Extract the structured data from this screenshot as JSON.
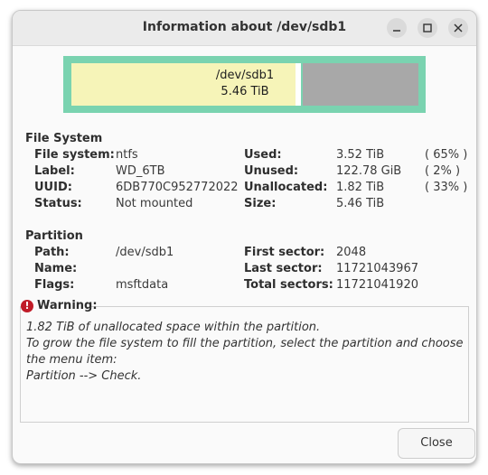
{
  "window": {
    "title": "Information about /dev/sdb1"
  },
  "usage_bar": {
    "label_path": "/dev/sdb1",
    "label_size": "5.46 TiB",
    "used_fraction": 0.65,
    "unused_fraction": 0.02,
    "unallocated_fraction": 0.33,
    "colors": {
      "border": "#7ad3b0",
      "used": "#f6f4b8",
      "unused": "#ffffff",
      "unallocated": "#a8a8a8"
    }
  },
  "file_system": {
    "heading": "File System",
    "fs_label": "File system:",
    "fs_value": "ntfs",
    "label_label": "Label:",
    "label_value": "WD_6TB",
    "uuid_label": "UUID:",
    "uuid_value": "6DB770C952772022",
    "status_label": "Status:",
    "status_value": "Not mounted",
    "used_label": "Used:",
    "used_value": "3.52 TiB",
    "used_pct": "( 65% )",
    "unused_label": "Unused:",
    "unused_value": "122.78 GiB",
    "unused_pct": "( 2% )",
    "unalloc_label": "Unallocated:",
    "unalloc_value": "1.82 TiB",
    "unalloc_pct": "( 33% )",
    "size_label": "Size:",
    "size_value": "5.46 TiB"
  },
  "partition": {
    "heading": "Partition",
    "path_label": "Path:",
    "path_value": "/dev/sdb1",
    "name_label": "Name:",
    "name_value": "",
    "flags_label": "Flags:",
    "flags_value": "msftdata",
    "first_label": "First sector:",
    "first_value": "2048",
    "last_label": "Last sector:",
    "last_value": "11721043967",
    "total_label": "Total sectors:",
    "total_value": "11721041920"
  },
  "warning": {
    "title": "Warning:",
    "icon": "error-icon",
    "line1": "1.82 TiB of unallocated space within the partition.",
    "line2": "To grow the file system to fill the partition, select the partition and choose the menu item:",
    "line3": "Partition --> Check."
  },
  "buttons": {
    "close_label": "Close"
  }
}
